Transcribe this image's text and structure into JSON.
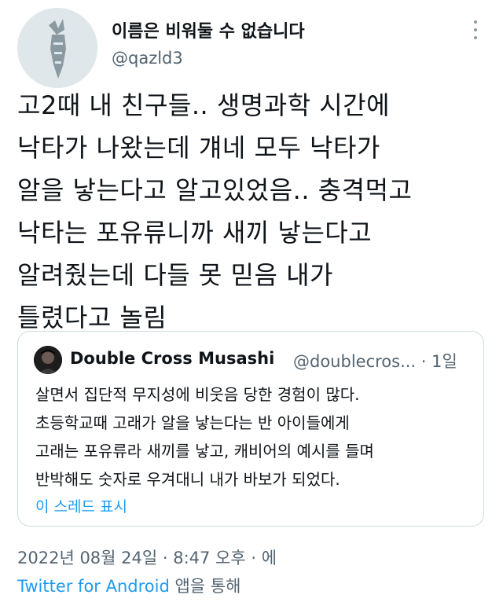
{
  "tweet": {
    "display_name": "이름은 비워둘 수 없습니다",
    "handle": "@qazld3",
    "body_lines": [
      "고2때 내 친구들.. 생명과학 시간에",
      "낙타가 나왔는데 걔네 모두 낙타가",
      "알을 낳는다고 알고있었음.. 충격먹고",
      "낙타는 포유류니까 새끼 낳는다고",
      "알려줬는데 다들 못 믿음 내가",
      "틀렸다고 놀림"
    ],
    "timestamp": "2022년 08월 24일 · 8:47 오후 · 에",
    "source": "Twitter for Android",
    "source_suffix": " 앱을 통해"
  },
  "quoted": {
    "display_name": "Double Cross Musashi",
    "handle_time": "@doublecros... · 1일",
    "body_lines": [
      "살면서 집단적 무지성에 비웃음 당한 경험이 많다.",
      "초등학교때 고래가 알을 낳는다는 반 아이들에게",
      "고래는 포유류라 새끼를 낳고, 캐비어의 예시를 들며",
      "반박해도 숫자로 우겨대니 내가 바보가 되었다."
    ],
    "show_thread": "이 스레드 표시"
  },
  "icons": {
    "more": "more-vertical-icon"
  },
  "colors": {
    "text": "#0f1419",
    "secondary": "#536471",
    "link": "#1d9bf0",
    "border": "#cfd9de"
  }
}
